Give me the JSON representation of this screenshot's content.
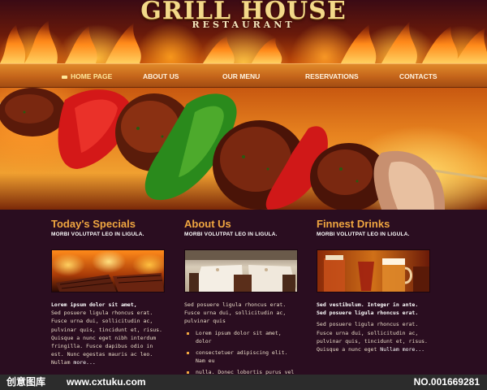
{
  "header": {
    "title": "GRILL HOUSE",
    "subtitle": "RESTAURANT"
  },
  "nav": {
    "items": [
      {
        "label": "HOME PAGE",
        "active": true
      },
      {
        "label": "ABOUT US",
        "active": false
      },
      {
        "label": "OUR MENU",
        "active": false
      },
      {
        "label": "RESERVATIONS",
        "active": false
      },
      {
        "label": "CONTACTS",
        "active": false
      }
    ]
  },
  "columns": [
    {
      "title": "Today's Specials",
      "subtitle": "MORBI VOLUTPAT LEO IN LIGULA.",
      "image": "grill-fire-image",
      "bold_line": "Lorem ipsum dolor sit amet,",
      "text": "Sed posuere ligula rhoncus erat. Fusce urna dui, sollicitudin ac, pulvinar quis, tincidunt et, risus. Quisque a nunc eget nibh interdum fringilla. Fusce dapibus odio in est. Nunc egestas mauris ac leo. Nullam",
      "more": "more..."
    },
    {
      "title": "About Us",
      "subtitle": "MORBI VOLUTPAT LEO IN LIGULA.",
      "image": "dining-room-image",
      "text": "Sed posuere ligula rhoncus erat. Fusce urna dui, sollicitudin ac, pulvinar quis",
      "bullets": [
        "Lorem ipsum dolor sit amet, dolor",
        "consectetuer adipiscing elit. Nam eu",
        "nulla. Donec lobortis purus vel urna."
      ]
    },
    {
      "title": "Finnest Drinks",
      "subtitle": "MORBI VOLUTPAT LEO IN LIGULA.",
      "image": "drinks-image",
      "bold_lines": [
        "Sed vestibulum. Integer in ante.",
        "Sed posuere ligula rhoncus erat."
      ],
      "text": "Sed posuere ligula rhoncus erat. Fusce urna dui, sollicitudin ac, pulvinar quis, tincidunt et, risus. Quisque a nunc eget",
      "link": "Nullam",
      "more": "more..."
    }
  ],
  "watermark": {
    "brand": "创意图库",
    "site": "www.cxtuku.com",
    "number": "NO.001669281"
  },
  "colors": {
    "background": "#2a0d20",
    "nav": "#c4641a",
    "accent": "#f0a640"
  }
}
